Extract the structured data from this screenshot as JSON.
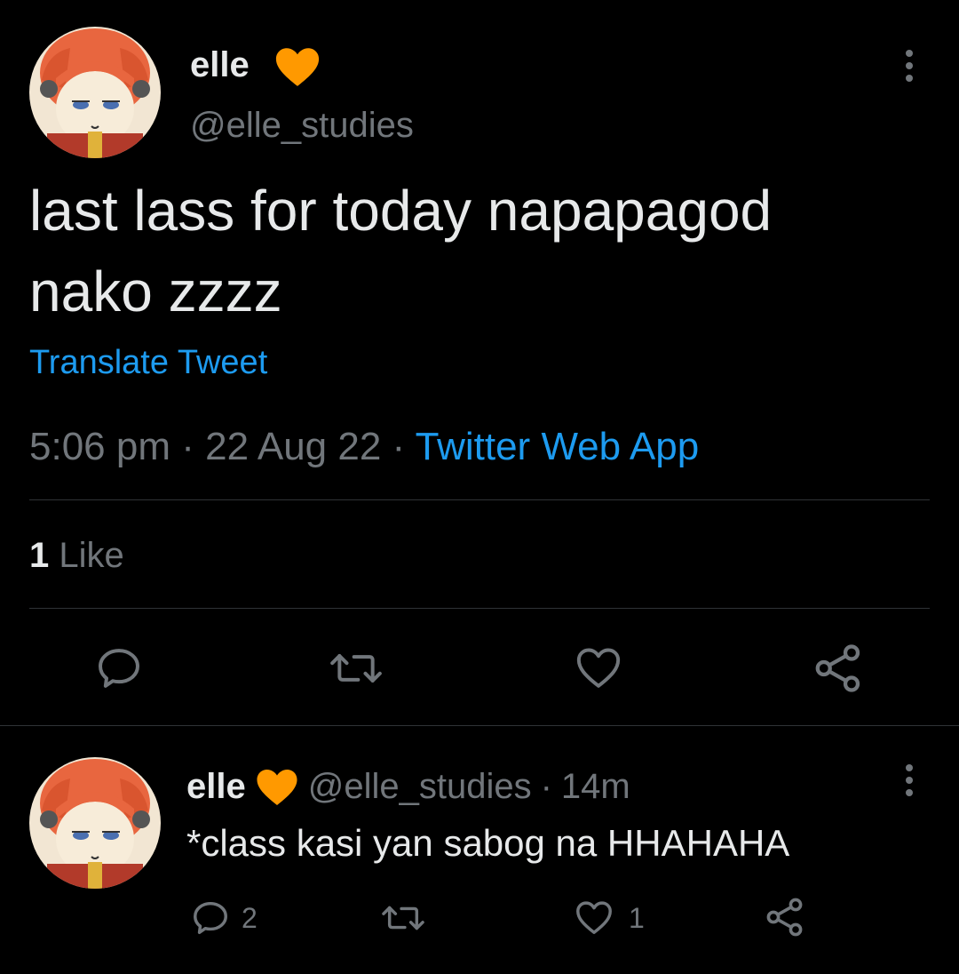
{
  "main_tweet": {
    "author_name": "elle",
    "author_handle": "@elle_studies",
    "text": "last lass for today napapagod nako zzzz",
    "translate_label": "Translate Tweet",
    "time": "5:06 pm",
    "date": "22 Aug 22",
    "separator": "·",
    "source": "Twitter Web App",
    "likes_count": "1",
    "likes_label": "Like"
  },
  "reply": {
    "author_name": "elle",
    "author_handle": "@elle_studies",
    "separator": "·",
    "time_ago": "14m",
    "text": "*class kasi yan sabog na HHAHAHA",
    "reply_count": "2",
    "like_count": "1"
  },
  "icons": {
    "verified": "heart-badge-icon",
    "more": "more-vertical-icon",
    "reply": "reply-icon",
    "retweet": "retweet-icon",
    "like": "heart-icon",
    "share": "share-icon"
  },
  "colors": {
    "background": "#000000",
    "text": "#e7e9ea",
    "secondary": "#71767b",
    "link": "#1d9bf0",
    "badge": "#ff9900",
    "divider": "#2f3336"
  }
}
